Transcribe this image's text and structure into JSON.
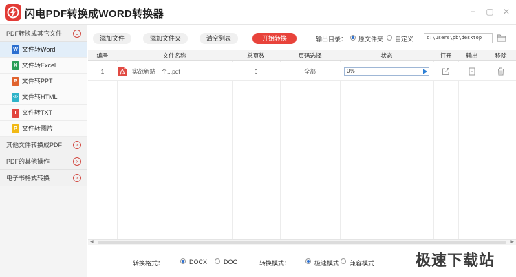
{
  "app": {
    "title": "闪电PDF转换成WORD转换器"
  },
  "window_controls": {
    "minimize": "−",
    "maximize": "▢",
    "close": "✕"
  },
  "sidebar": {
    "sections": [
      {
        "label": "PDF转换成其它文件",
        "expanded": true
      },
      {
        "label": "其他文件转换成PDF",
        "expanded": false
      },
      {
        "label": "PDF的其他操作",
        "expanded": false
      },
      {
        "label": "电子书格式转换",
        "expanded": false
      }
    ],
    "items": [
      {
        "label": "文件转Word",
        "icon": "W",
        "color": "#2b6fd0",
        "active": true
      },
      {
        "label": "文件转Excel",
        "icon": "X",
        "color": "#2a9d57",
        "active": false
      },
      {
        "label": "文件转PPT",
        "icon": "P",
        "color": "#e0632e",
        "active": false
      },
      {
        "label": "文件转HTML",
        "icon": "</>",
        "color": "#2fb3c9",
        "active": false
      },
      {
        "label": "文件转TXT",
        "icon": "T",
        "color": "#e2463f",
        "active": false
      },
      {
        "label": "文件转图片",
        "icon": "P",
        "color": "#f1b916",
        "active": false
      }
    ]
  },
  "toolbar": {
    "add_file": "添加文件",
    "add_folder": "添加文件夹",
    "clear_list": "清空列表",
    "start": "开始转换",
    "output_label": "输出目录：",
    "option_source": "原文件夹",
    "option_custom": "自定义",
    "path": "c:\\users\\pb\\desktop",
    "accent": "#e8433b"
  },
  "table": {
    "headers": [
      "编号",
      "文件名称",
      "总页数",
      "页码选择",
      "状态",
      "打开",
      "输出",
      "移除"
    ],
    "rows": [
      {
        "index": "1",
        "filename": "实战新站一个...pdf",
        "pages": "6",
        "page_select": "全部",
        "progress": "0%"
      }
    ]
  },
  "bottom": {
    "format_label": "转换格式：",
    "format_docx": "DOCX",
    "format_doc": "DOC",
    "mode_label": "转换模式：",
    "mode_fast": "极速模式",
    "mode_compat": "兼容模式"
  },
  "watermark": "极速下载站"
}
